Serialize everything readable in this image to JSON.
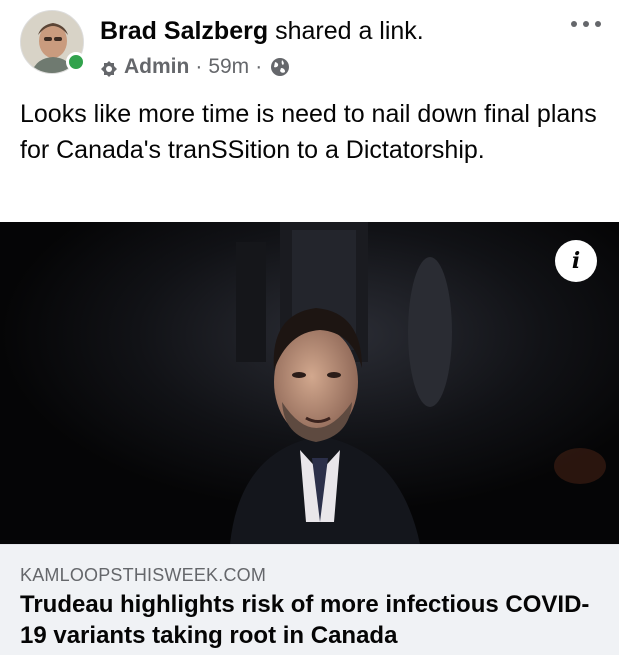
{
  "post": {
    "author_name": "Brad Salzberg",
    "action": "shared a link.",
    "role": "Admin",
    "separator": "·",
    "time": "59m",
    "text": "Looks like more time is need to nail down final plans for Canada's tranSSition to a Dictatorship."
  },
  "link": {
    "domain": "KAMLOOPSTHISWEEK.COM",
    "title": "Trudeau highlights risk of more infectious COVID-19 variants taking root in Canada",
    "info_glyph": "i"
  },
  "icons": {
    "more": "more-options-icon",
    "admin": "admin-badge-icon",
    "audience": "globe-icon",
    "info": "info-icon",
    "online": "online-status-icon"
  },
  "colors": {
    "online": "#31a24c",
    "meta_text": "#65676b",
    "preview_bg": "#f0f2f5"
  }
}
